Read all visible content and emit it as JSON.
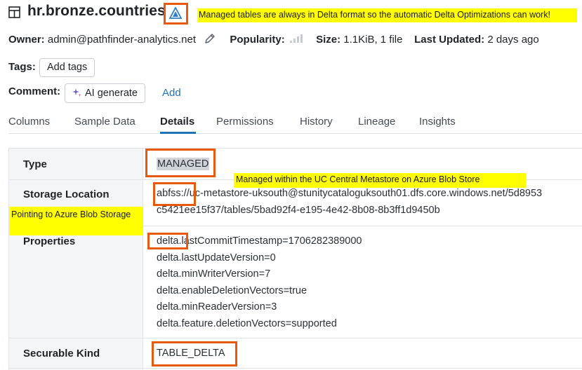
{
  "header": {
    "title": "hr.bronze.countries",
    "icons": {
      "table": "table-icon",
      "delta": "delta-icon"
    }
  },
  "annotations": {
    "top_note": "Managed tables are always in Delta format so the automatic Delta Optimizations can work!",
    "metastore_note": "Managed within the UC Central Metastore on Azure Blob Store",
    "storage_note": "Pointing to Azure Blob Storage",
    "highlight_color": "#ffff00",
    "box_color": "#e8590c"
  },
  "meta": {
    "owner_label": "Owner:",
    "owner_value": "admin@pathfinder-analytics.net",
    "popularity_label": "Popularity:",
    "size_label": "Size:",
    "size_value": "1.1KiB, 1 file",
    "updated_label": "Last Updated:",
    "updated_value": "2 days ago"
  },
  "tags": {
    "label": "Tags:",
    "add_button": "Add tags"
  },
  "comment": {
    "label": "Comment:",
    "ai_button": "AI generate",
    "add_link": "Add"
  },
  "tabs": [
    {
      "label": "Columns"
    },
    {
      "label": "Sample Data"
    },
    {
      "label": "Details",
      "active": true
    },
    {
      "label": "Permissions"
    },
    {
      "label": "History"
    },
    {
      "label": "Lineage"
    },
    {
      "label": "Insights"
    }
  ],
  "details": {
    "type_label": "Type",
    "type_value": "MANAGED",
    "storage_label": "Storage Location",
    "storage_line1": "abfss://uc-metastore-uksouth@stunitycataloguksouth01.dfs.core.windows.net/5d8953",
    "storage_line2": "c5421ee15f37/tables/5bad92f4-e195-4e42-8b08-8b3ff1d9450b",
    "properties_label": "Properties",
    "properties": [
      "delta.lastCommitTimestamp=1706282389000",
      "delta.lastUpdateVersion=0",
      "delta.minWriterVersion=7",
      "delta.enableDeletionVectors=true",
      "delta.minReaderVersion=3",
      "delta.feature.deletionVectors=supported"
    ],
    "securable_label": "Securable Kind",
    "securable_value": "TABLE_DELTA"
  },
  "colors": {
    "accent": "#2272b4",
    "label_bg": "#f4f5f7"
  }
}
